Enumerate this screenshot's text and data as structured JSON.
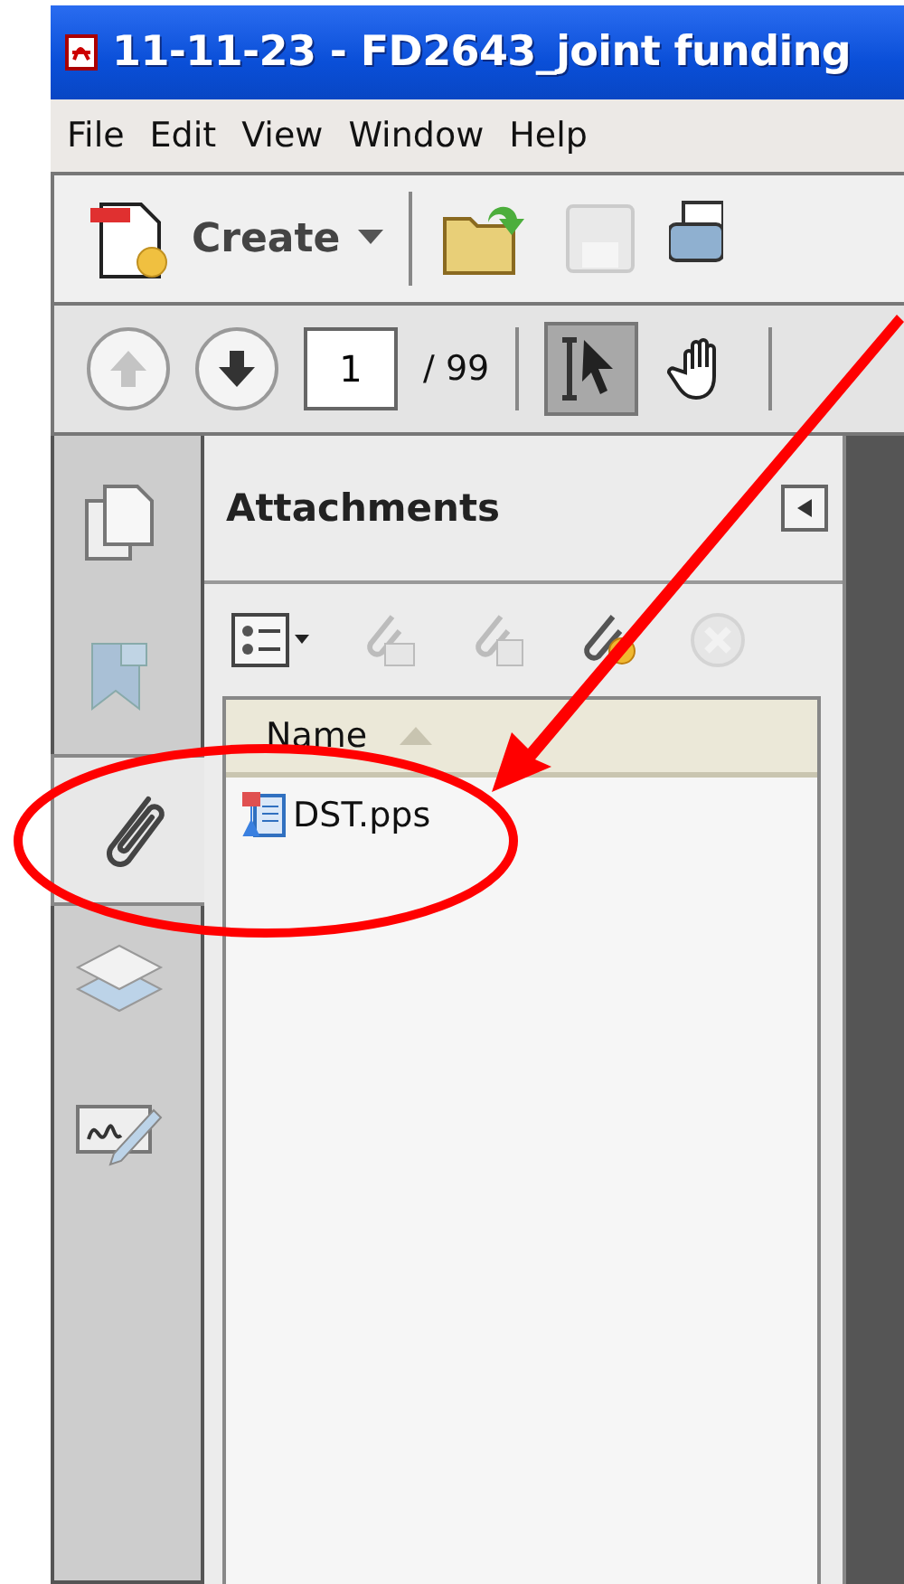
{
  "window": {
    "title": "11-11-23 - FD2643_joint funding"
  },
  "menu": [
    "File",
    "Edit",
    "View",
    "Window",
    "Help"
  ],
  "toolbar": {
    "create_label": "Create"
  },
  "navigation": {
    "previous_disabled": true,
    "next_disabled": false,
    "page": "1",
    "total": "/ 99",
    "tools": [
      {
        "kind": "select",
        "selected": true
      },
      {
        "kind": "hand",
        "selected": false
      }
    ]
  },
  "sidebar": {
    "tabs": [
      {
        "kind": "pages",
        "selected": false
      },
      {
        "kind": "bookmarks",
        "selected": false
      },
      {
        "kind": "attachments",
        "selected": true
      },
      {
        "kind": "layers",
        "selected": false
      },
      {
        "kind": "signatures",
        "selected": false
      }
    ]
  },
  "attachments": {
    "title": "Attachments",
    "tools": [
      {
        "kind": "options",
        "disabled": false
      },
      {
        "kind": "open",
        "disabled": true
      },
      {
        "kind": "save",
        "disabled": true
      },
      {
        "kind": "add",
        "disabled": false
      },
      {
        "kind": "delete",
        "disabled": true
      }
    ],
    "columns": [
      {
        "label": "Name",
        "sorted": true
      }
    ],
    "rows": [
      {
        "name": "DST.pps"
      }
    ]
  }
}
